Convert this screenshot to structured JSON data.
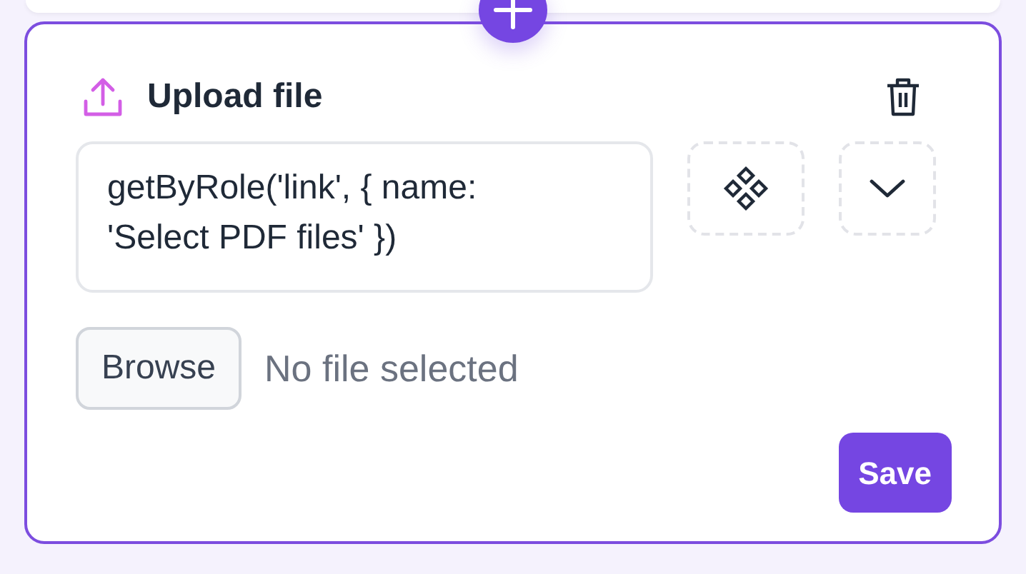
{
  "step": {
    "title": "Upload file",
    "locator": "getByRole('link', { name: 'Select PDF files' })",
    "file_input": {
      "button": "Browse",
      "status": "No file selected"
    },
    "save_button": "Save"
  }
}
